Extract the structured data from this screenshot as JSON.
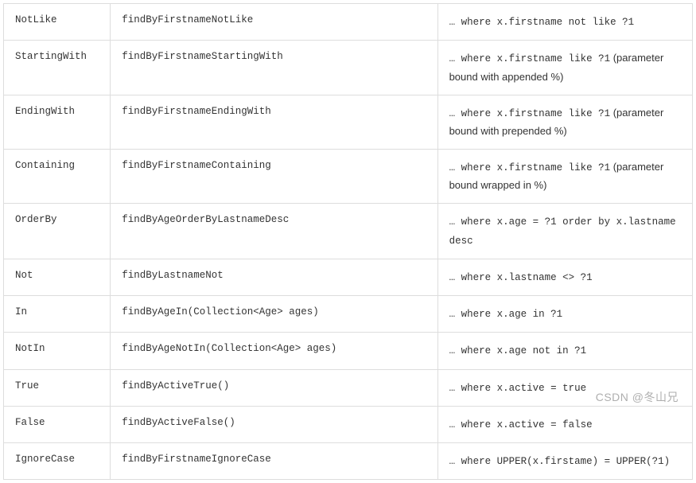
{
  "rows": [
    {
      "keyword": "NotLike",
      "sample": "findByFirstnameNotLike",
      "sql": "… where x.firstname not like ?1",
      "note": ""
    },
    {
      "keyword": "StartingWith",
      "sample": "findByFirstnameStartingWith",
      "sql": "… where x.firstname like ?1",
      "note": " (parameter bound with appended %)"
    },
    {
      "keyword": "EndingWith",
      "sample": "findByFirstnameEndingWith",
      "sql": "… where x.firstname like ?1",
      "note": " (parameter bound with prepended %)"
    },
    {
      "keyword": "Containing",
      "sample": "findByFirstnameContaining",
      "sql": "… where x.firstname like ?1",
      "note": " (parameter bound wrapped in %)"
    },
    {
      "keyword": "OrderBy",
      "sample": "findByAgeOrderByLastnameDesc",
      "sql": "… where x.age = ?1 order by x.lastname desc",
      "note": ""
    },
    {
      "keyword": "Not",
      "sample": "findByLastnameNot",
      "sql": "… where x.lastname <> ?1",
      "note": ""
    },
    {
      "keyword": "In",
      "sample": "findByAgeIn(Collection<Age> ages)",
      "sql": "… where x.age in ?1",
      "note": ""
    },
    {
      "keyword": "NotIn",
      "sample": "findByAgeNotIn(Collection<Age> ages)",
      "sql": "… where x.age not in ?1",
      "note": ""
    },
    {
      "keyword": "True",
      "sample": "findByActiveTrue()",
      "sql": "… where x.active = true",
      "note": ""
    },
    {
      "keyword": "False",
      "sample": "findByActiveFalse()",
      "sql": "… where x.active = false",
      "note": ""
    },
    {
      "keyword": "IgnoreCase",
      "sample": "findByFirstnameIgnoreCase",
      "sql": "… where UPPER(x.firstame) = UPPER(?1)",
      "note": ""
    }
  ],
  "watermark": "CSDN @冬山兄"
}
